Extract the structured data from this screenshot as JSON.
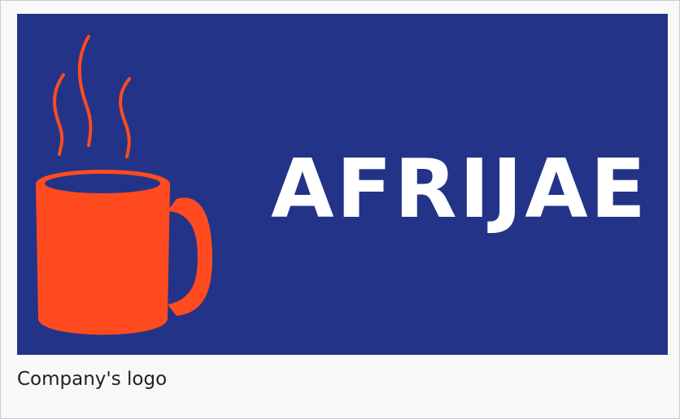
{
  "logo": {
    "wordmark": "AFRIJAE",
    "icon": "coffee-mug-icon",
    "background_color": "#233488",
    "mug_color": "#ff4b1f",
    "text_color": "#ffffff"
  },
  "caption": {
    "text": "Company's logo"
  }
}
